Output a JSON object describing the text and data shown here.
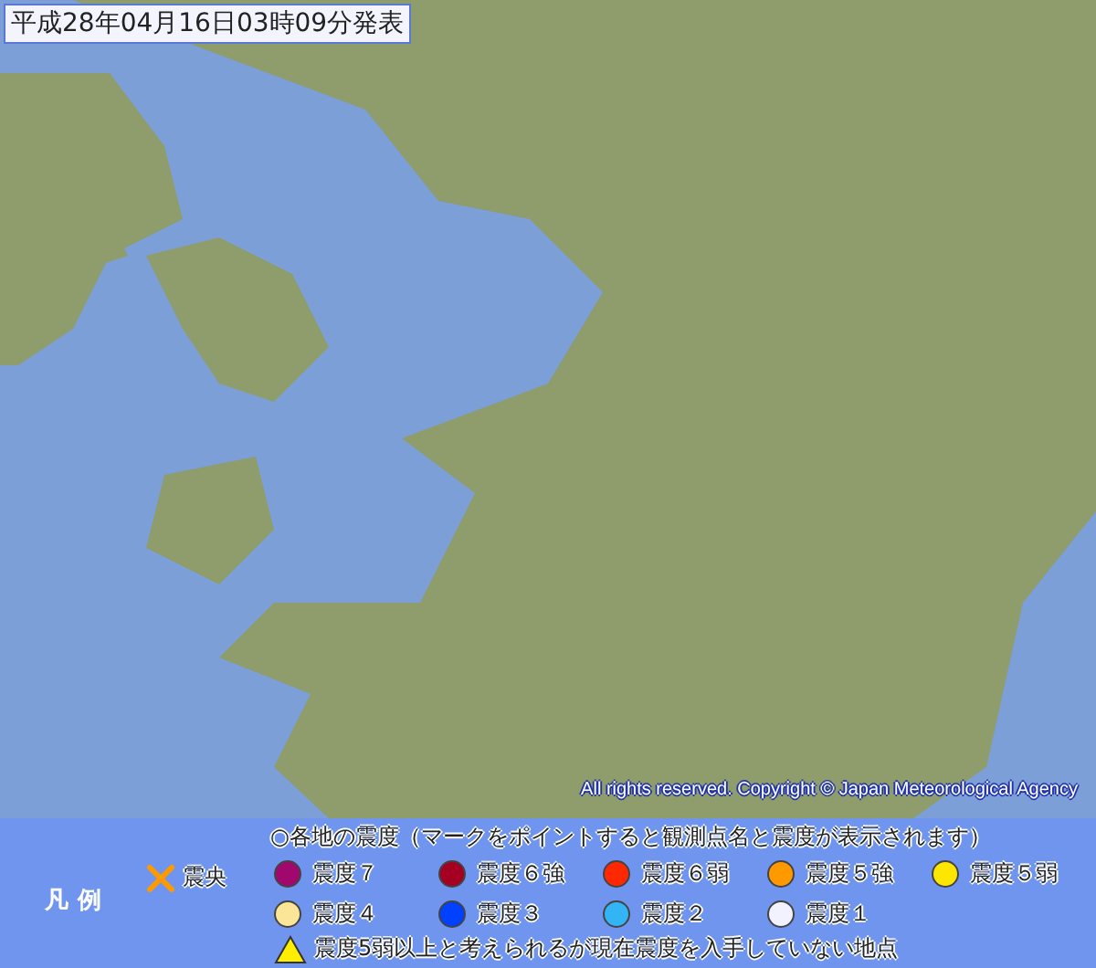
{
  "title": "平成28年04月16日03時09分発表",
  "copyright": "All rights reserved. Copyright © Japan Meteorological Agency",
  "legend": {
    "label": "凡 例",
    "epicenter": {
      "label": "震央",
      "color": "#ff9900"
    },
    "heading": "○各地の震度（マークをポイントすると観測点名と震度が表示されます）",
    "items": [
      {
        "label": "震度７",
        "color": "#a0086e"
      },
      {
        "label": "震度６強",
        "color": "#a50021"
      },
      {
        "label": "震度６弱",
        "color": "#ff2800"
      },
      {
        "label": "震度５強",
        "color": "#ff9900"
      },
      {
        "label": "震度５弱",
        "color": "#ffe600"
      },
      {
        "label": "震度４",
        "color": "#fae696"
      },
      {
        "label": "震度３",
        "color": "#0041ff"
      },
      {
        "label": "震度２",
        "color": "#33b5f5"
      },
      {
        "label": "震度１",
        "color": "#f2f2ff"
      }
    ],
    "note": {
      "label": "震度5弱以上と考えられるが現在震度を入手していない地点",
      "color": "#ffee00"
    }
  }
}
